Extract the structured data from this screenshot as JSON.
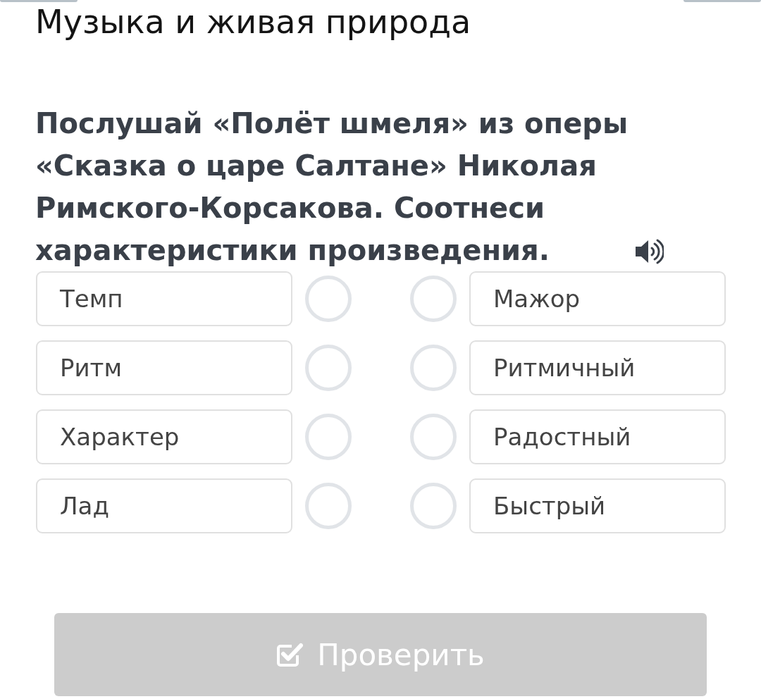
{
  "header": {
    "title": "Музыка и живая природа"
  },
  "question": {
    "text": "Послушай «Полёт шмеля» из оперы «Сказка о царе Салтане» Николая Римского-Корсакова. Соотнеси характеристики произведения."
  },
  "matching": {
    "left": [
      {
        "label": "Темп"
      },
      {
        "label": "Ритм"
      },
      {
        "label": "Характер"
      },
      {
        "label": "Лад"
      }
    ],
    "right": [
      {
        "label": "Мажор"
      },
      {
        "label": "Ритмичный"
      },
      {
        "label": "Радостный"
      },
      {
        "label": "Быстрый"
      }
    ]
  },
  "check_button": {
    "label": "Проверить",
    "disabled": true
  }
}
